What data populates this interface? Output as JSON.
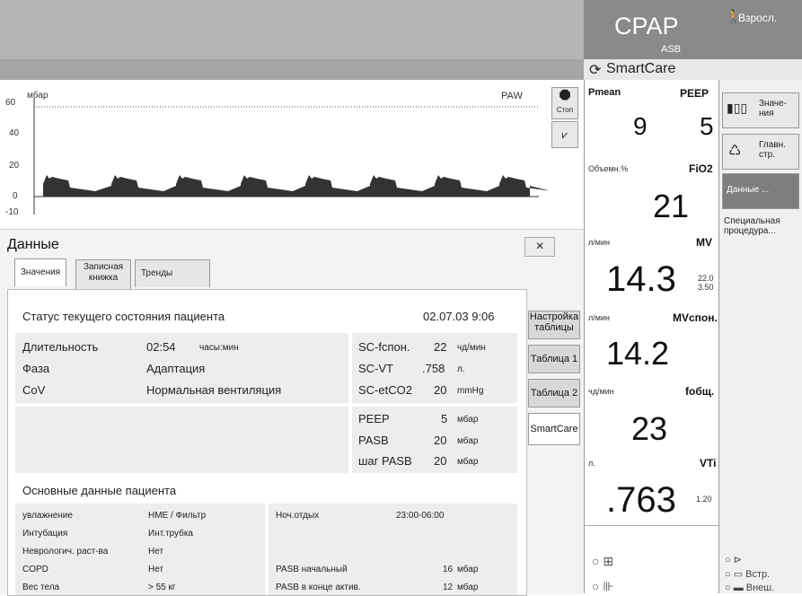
{
  "header": {
    "mode": "CPAP",
    "submode": "ASB",
    "patient_type": "Взросл."
  },
  "smartcare": {
    "title": "SmartCare"
  },
  "waveform": {
    "unit": "мбар",
    "label": "PAW",
    "y_ticks": [
      "60",
      "40",
      "20",
      "0",
      "-10"
    ],
    "stop_label": "Стоп"
  },
  "panel": {
    "title": "Данные",
    "close": "×",
    "tabs": [
      {
        "label": "Значения"
      },
      {
        "label": "Записная книжка"
      },
      {
        "label": "Тренды"
      }
    ],
    "side_tabs": [
      {
        "label": "Настройка таблицы"
      },
      {
        "label": "Таблица 1"
      },
      {
        "label": "Таблица 2"
      },
      {
        "label": "SmartCare"
      }
    ],
    "status": {
      "title": "Статус текущего состояния пациента",
      "datetime": "02.07.03  9:06",
      "rows": [
        {
          "label": "Длительность",
          "value": "02:54",
          "unit": "часы:мин"
        },
        {
          "label": "Фаза",
          "value": "Адаптация"
        },
        {
          "label": "CoV",
          "value": "Нормальная вентиляция"
        }
      ],
      "sc": [
        {
          "label": "SC-fспон.",
          "value": "22",
          "unit": "чд/мин"
        },
        {
          "label": "SC-VT",
          "value": ".758",
          "unit": "л."
        },
        {
          "label": "SC-etCO2",
          "value": "20",
          "unit": "mmHg"
        }
      ],
      "settings": [
        {
          "label": "PEEP",
          "value": "5",
          "unit": "мбар"
        },
        {
          "label": "PASB",
          "value": "20",
          "unit": "мбар"
        },
        {
          "label": "шаг PASB",
          "value": "20",
          "unit": "мбар"
        }
      ]
    },
    "basic": {
      "title": "Основные данные пациента",
      "rows": [
        {
          "label": "увлажнение",
          "value": "HME / Фильтр"
        },
        {
          "label": "Интубация",
          "value": "Инт.трубка"
        },
        {
          "label": "Неврологич. раст-ва",
          "value": "Нет"
        },
        {
          "label": "COPD",
          "value": "Нет"
        },
        {
          "label": "Вес тела",
          "value": "> 55 кг"
        }
      ],
      "right": [
        {
          "label": "Ноч.отдых",
          "value": "23:00-06:00",
          "unit": ""
        },
        {
          "label": "PASB начальный",
          "value": "16",
          "unit": "мбар"
        },
        {
          "label": "PASB в конце актив.",
          "value": "12",
          "unit": "мбар"
        }
      ]
    }
  },
  "params": {
    "pmean": {
      "name": "Pmean",
      "value": "9"
    },
    "peep": {
      "name": "PEEP",
      "value": "5"
    },
    "fio2": {
      "name": "FiO2",
      "unit": "Объемн.%",
      "value": "21"
    },
    "mv": {
      "name": "MV",
      "unit": "л/мин",
      "value": "14.3",
      "hi": "22.0",
      "lo": "3.50"
    },
    "mvspon": {
      "name": "MVспон.",
      "unit": "л/мин",
      "value": "14.2"
    },
    "ftot": {
      "name": "fобщ.",
      "unit": "чд/мин",
      "value": "23"
    },
    "vti": {
      "name": "VTi",
      "unit": "л.",
      "value": ".763",
      "hi": "1.20"
    }
  },
  "menu": {
    "values": "Значе-ния",
    "main": "Главн. стр.",
    "data": "Данные ...",
    "special": "Специальная процедура...",
    "bottom1": "Встр.",
    "bottom2": "Внеш."
  }
}
